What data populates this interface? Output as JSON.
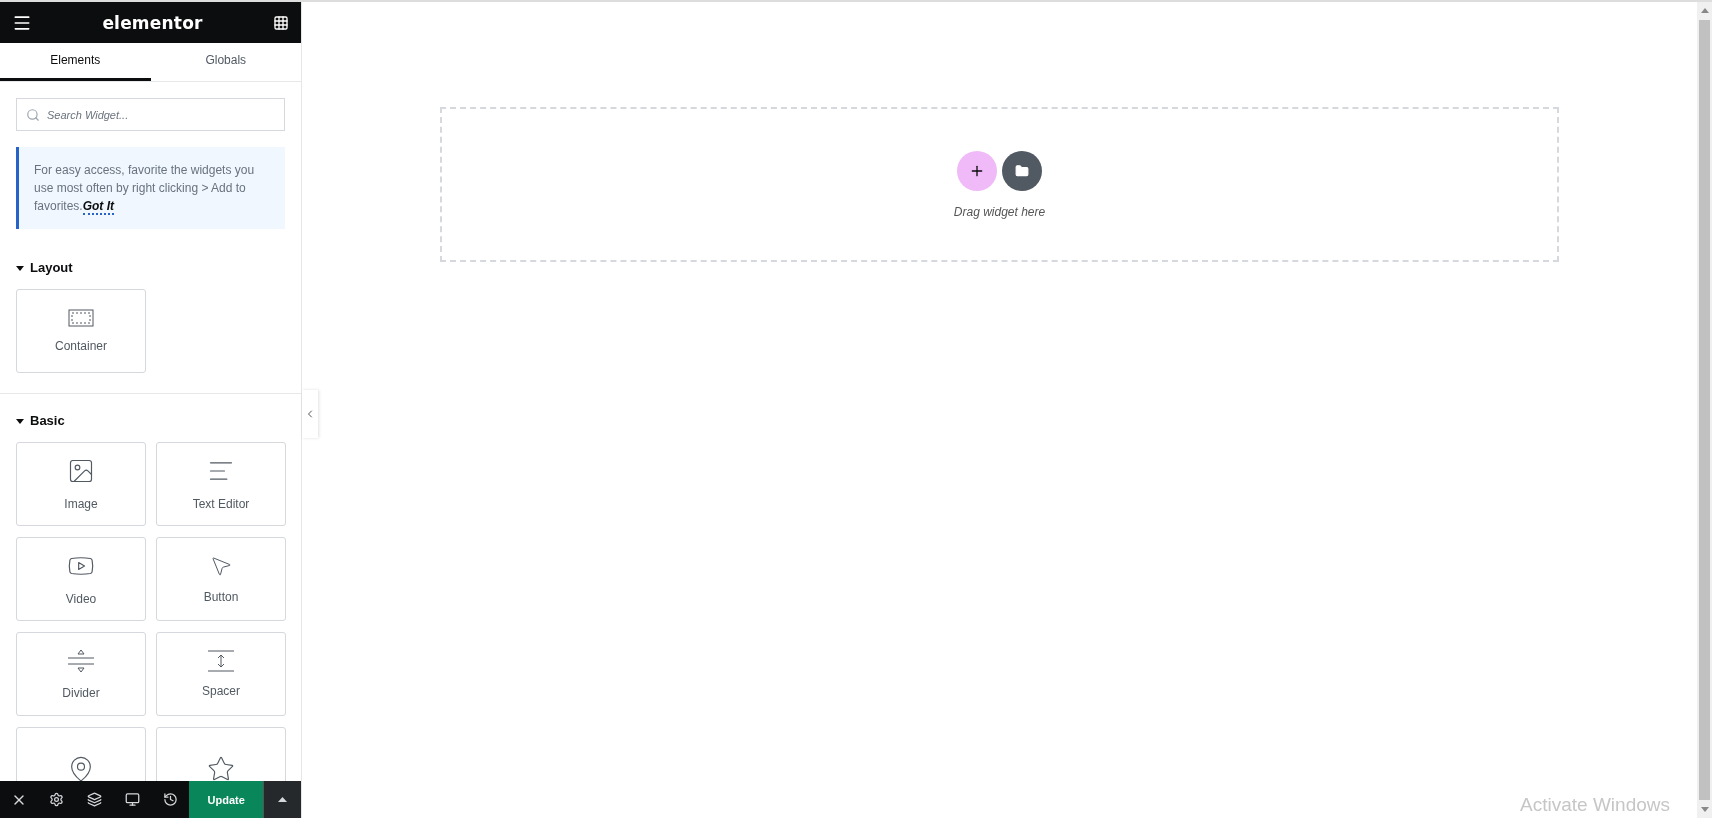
{
  "header": {
    "title": "elementor"
  },
  "tabs": [
    {
      "label": "Elements",
      "selected": true
    },
    {
      "label": "Globals",
      "selected": false
    }
  ],
  "search": {
    "placeholder": "Search Widget..."
  },
  "notice": {
    "text": "For easy access, favorite the widgets you use most often by right clicking > Add to favorites.",
    "link": "Got It"
  },
  "categories": [
    {
      "title": "Layout",
      "expanded": true,
      "widgets": [
        {
          "kind": "widget",
          "label": "Container"
        }
      ]
    },
    {
      "title": "Basic",
      "expanded": true,
      "widgets": [
        {
          "kind": "widget",
          "label": "Image"
        },
        {
          "kind": "widget",
          "label": "Text Editor"
        },
        {
          "kind": "widget",
          "label": "Video"
        },
        {
          "kind": "widget",
          "label": "Button"
        },
        {
          "kind": "widget",
          "label": "Divider"
        },
        {
          "kind": "widget",
          "label": "Spacer"
        },
        {
          "kind": "widget"
        },
        {
          "kind": "widget"
        }
      ]
    }
  ],
  "footer": {
    "update": "Update"
  },
  "canvas": {
    "hint": "Drag widget here"
  },
  "os_notice": "Activate Windows"
}
